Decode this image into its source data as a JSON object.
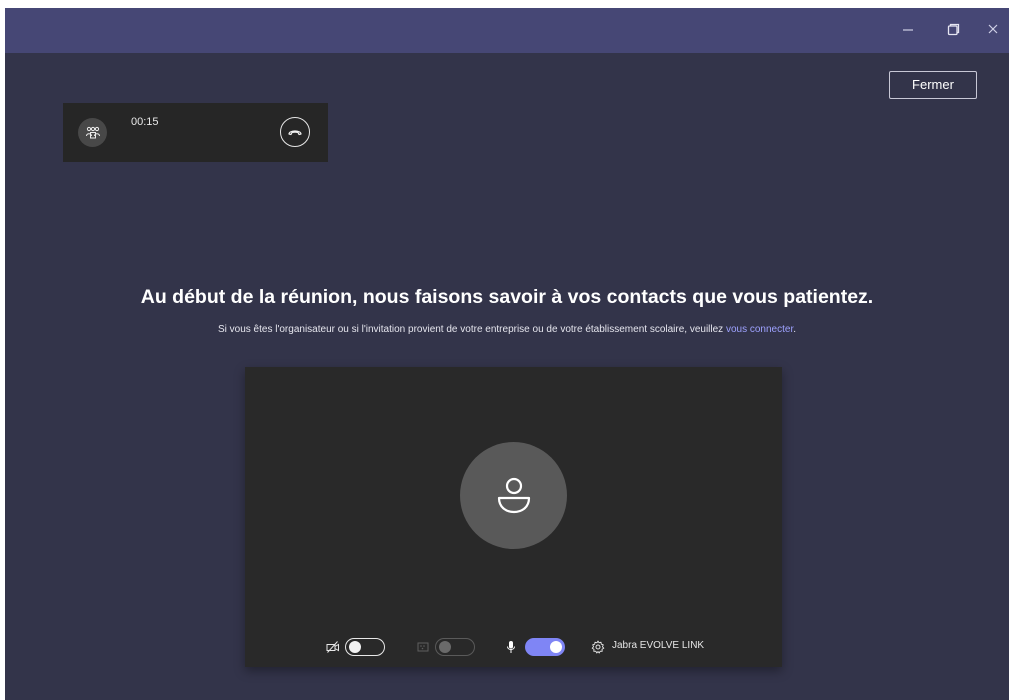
{
  "window": {
    "controls": {
      "minimize_icon": "minimize-icon",
      "maximize_icon": "maximize-icon",
      "close_icon": "close-icon"
    },
    "titlebar_color": "#464775",
    "background_color": "#33344a"
  },
  "close_button": {
    "label": "Fermer"
  },
  "mini_call": {
    "timer": "00:15",
    "avatar_icon": "people-icon",
    "hangup_icon": "hang-up-icon"
  },
  "main": {
    "headline": "Au début de la réunion, nous faisons savoir à vos contacts que vous patientez.",
    "subline_prefix": "Si vous êtes l'organisateur ou si l'invitation provient de votre entreprise ou de votre établissement scolaire, veuillez ",
    "subline_link": "vous connecter",
    "subline_suffix": "."
  },
  "preview": {
    "avatar_icon": "person-icon",
    "controls": {
      "camera": {
        "icon": "camera-off-icon",
        "state": "off"
      },
      "blur": {
        "icon": "background-blur-icon",
        "state": "disabled"
      },
      "microphone": {
        "icon": "microphone-icon",
        "state": "on"
      },
      "device": {
        "icon": "gear-icon",
        "label": "Jabra EVOLVE LINK"
      }
    },
    "accent_color": "#7f85f5"
  }
}
